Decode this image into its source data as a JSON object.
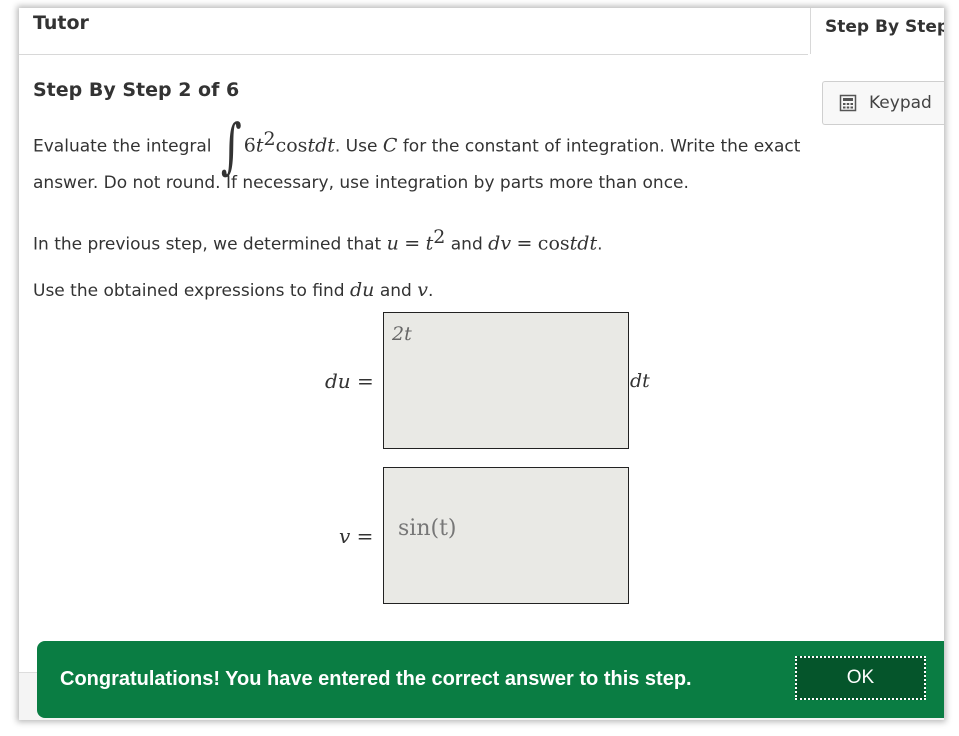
{
  "header": {
    "title": "Tutor",
    "side_tab": "Step By Step"
  },
  "keypad": {
    "label": "Keypad",
    "icon": "calculator-icon"
  },
  "step": {
    "title": "Step By Step 2 of 6",
    "prompt_a": "Evaluate the integral",
    "integral_coef": "6",
    "integral_var": "t",
    "integral_exp": "2",
    "integral_func": "cos",
    "integral_tail": "tdt",
    "prompt_b": ". Use",
    "constant": "C",
    "prompt_c": "for the constant of integration. Write the exact",
    "prompt_d": "answer. Do not round. If necessary, use integration by parts more than once.",
    "prev_a": "In the previous step, we determined that",
    "prev_u": "u",
    "prev_eq1": "=",
    "prev_t": "t",
    "prev_exp": "2",
    "prev_and": "and",
    "prev_dv": "dv",
    "prev_eq2": "=",
    "prev_cos": "cos",
    "prev_tdt": "tdt",
    "prev_end": ".",
    "use_a": "Use the obtained expressions to find",
    "use_du": "du",
    "use_and": "and",
    "use_v": "v",
    "use_end": "."
  },
  "answers": {
    "du_label": "du",
    "du_eq": "=",
    "du_value": "2t",
    "du_suffix": "dt",
    "v_label": "v",
    "v_eq": "=",
    "v_value": "sin(t)"
  },
  "toast": {
    "message": "Congratulations! You have entered the correct answer to this step.",
    "ok_label": "OK",
    "color": "#0a7d43"
  }
}
